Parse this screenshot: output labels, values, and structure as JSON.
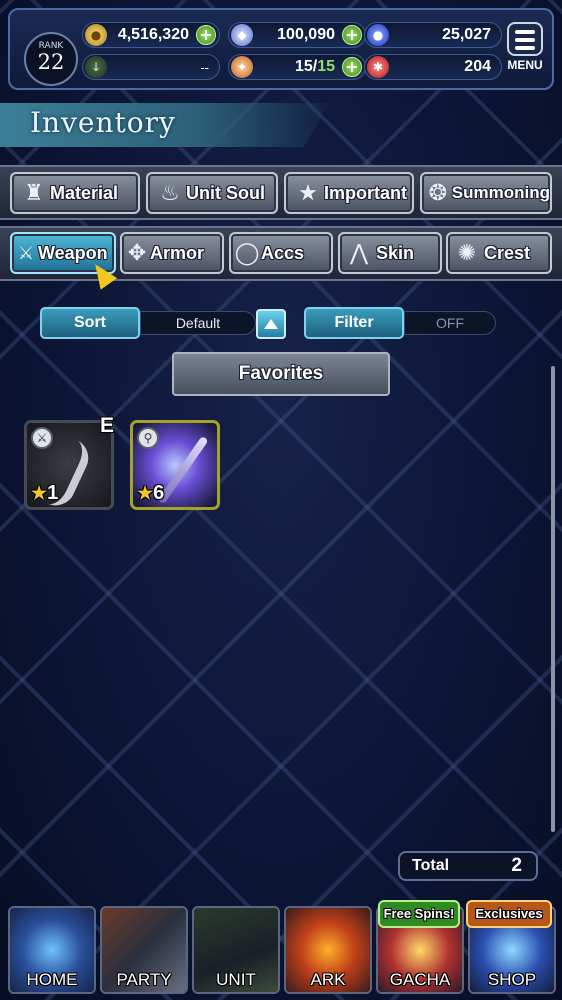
{
  "header": {
    "rank_label": "RANK",
    "rank_value": "22",
    "gil": "4,516,320",
    "crystals": "100,090",
    "blue_orbs": "25,027",
    "empty_stat": "--",
    "stamina": "15/",
    "stamina_max": "15",
    "red_orbs": "204",
    "menu_label": "MENU"
  },
  "page_title": "Inventory",
  "categories_row1": [
    {
      "label": "Material",
      "icon": "bag-icon"
    },
    {
      "label": "Unit Soul",
      "icon": "soul-flame-icon"
    },
    {
      "label": "Important",
      "icon": "star-icon"
    },
    {
      "label": "Summoning",
      "icon": "summon-crest-icon"
    }
  ],
  "categories_row2": [
    {
      "label": "Weapon",
      "icon": "sword-icon",
      "active": true
    },
    {
      "label": "Armor",
      "icon": "armor-icon"
    },
    {
      "label": "Accs",
      "icon": "ring-icon"
    },
    {
      "label": "Skin",
      "icon": "hanger-icon"
    },
    {
      "label": "Crest",
      "icon": "crest-icon"
    }
  ],
  "sort": {
    "label": "Sort",
    "value": "Default"
  },
  "filter": {
    "label": "Filter",
    "value": "OFF"
  },
  "favorites_label": "Favorites",
  "items": [
    {
      "rarity": "1",
      "equipped_mark": "E",
      "icon": "sword-type-icon"
    },
    {
      "rarity": "6",
      "icon": "staff-type-icon"
    }
  ],
  "total": {
    "label": "Total",
    "value": "2"
  },
  "nav": [
    {
      "label": "HOME"
    },
    {
      "label": "PARTY"
    },
    {
      "label": "UNIT"
    },
    {
      "label": "ARK"
    },
    {
      "label": "GACHA",
      "badge": "Free Spins!"
    },
    {
      "label": "SHOP",
      "badge": "Exclusives"
    }
  ],
  "colors": {
    "accent": "#3a9cbd",
    "active_tab": "#4fb8d8",
    "plus_green": "#3f8a1f",
    "star": "#f4c531"
  }
}
